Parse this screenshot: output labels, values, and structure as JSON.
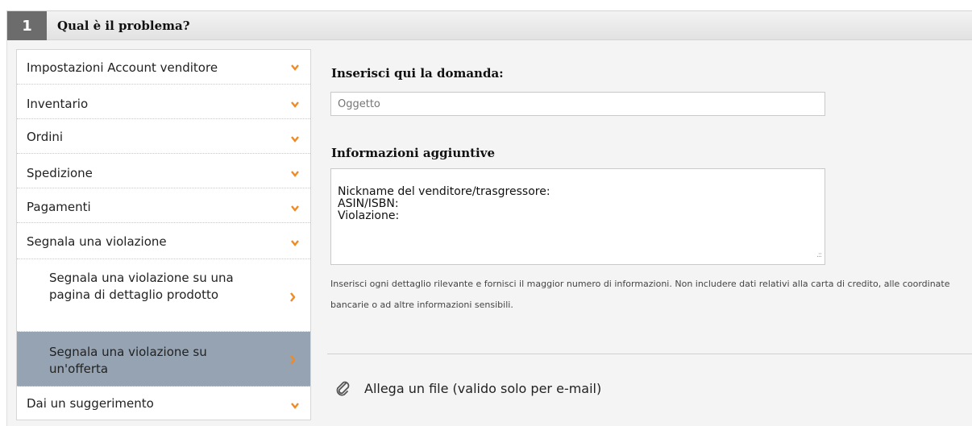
{
  "header": {
    "step_number": "1",
    "title": "Qual è il problema?"
  },
  "menu": {
    "items": [
      {
        "label": "Impostazioni Account venditore",
        "icon": "chevron-down-icon"
      },
      {
        "label": "Inventario",
        "icon": "chevron-down-icon"
      },
      {
        "label": "Ordini",
        "icon": "chevron-down-icon"
      },
      {
        "label": "Spedizione",
        "icon": "chevron-down-icon"
      },
      {
        "label": "Pagamenti",
        "icon": "chevron-down-icon"
      },
      {
        "label": "Segnala una violazione",
        "icon": "chevron-down-icon"
      },
      {
        "label": "Segnala una violazione su una pagina di dettaglio prodotto",
        "icon": "chevron-right-icon"
      },
      {
        "label": "Segnala una violazione su un'offerta",
        "icon": "chevron-right-icon",
        "selected": true
      },
      {
        "label": "Dai un suggerimento",
        "icon": "chevron-down-icon"
      }
    ]
  },
  "form": {
    "question_label": "Inserisci qui la domanda:",
    "subject_placeholder": "Oggetto",
    "info_label": "Informazioni aggiuntive",
    "info_value": "Nickname del venditore/trasgressore:\nASIN/ISBN:\nViolazione:",
    "help_text": "Inserisci ogni dettaglio rilevante e fornisci il maggior numero di informazioni. Non includere dati relativi alla carta di credito, alle coordinate bancarie o ad altre informazioni sensibili.",
    "attach_label": "Allega un file (valido solo per e-mail)"
  },
  "colors": {
    "chevron": "#f08a24",
    "selected_bg": "#95a3b2",
    "step_bg": "#6c6c6c"
  }
}
